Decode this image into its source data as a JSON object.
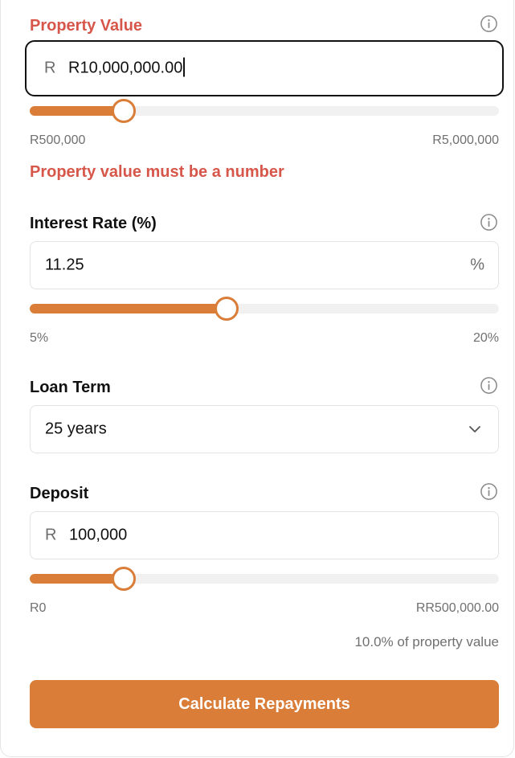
{
  "property_value": {
    "label": "Property Value",
    "prefix": "R",
    "value": "R10,000,000.00",
    "slider": {
      "level": 0.2,
      "min_label": "R500,000",
      "max_label": "R5,000,000"
    },
    "error": "Property value must be a number",
    "info_icon": "info-icon"
  },
  "interest_rate": {
    "label": "Interest Rate (%)",
    "value": "11.25",
    "suffix": "%",
    "slider": {
      "level": 0.42,
      "min_label": "5%",
      "max_label": "20%"
    },
    "info_icon": "info-icon"
  },
  "loan_term": {
    "label": "Loan Term",
    "selected": "25 years",
    "dropdown_icon": "chevron-down-icon",
    "info_icon": "info-icon"
  },
  "deposit": {
    "label": "Deposit",
    "prefix": "R",
    "value": "100,000",
    "slider": {
      "level": 0.2,
      "min_label": "R0",
      "max_label": "RR500,000.00"
    },
    "note": "10.0% of property value",
    "info_icon": "info-icon"
  },
  "actions": {
    "calculate_label": "Calculate Repayments"
  },
  "colors": {
    "accent": "#d97d38",
    "error": "#d6564a",
    "track": "#f1f1f1",
    "muted": "#707070"
  }
}
